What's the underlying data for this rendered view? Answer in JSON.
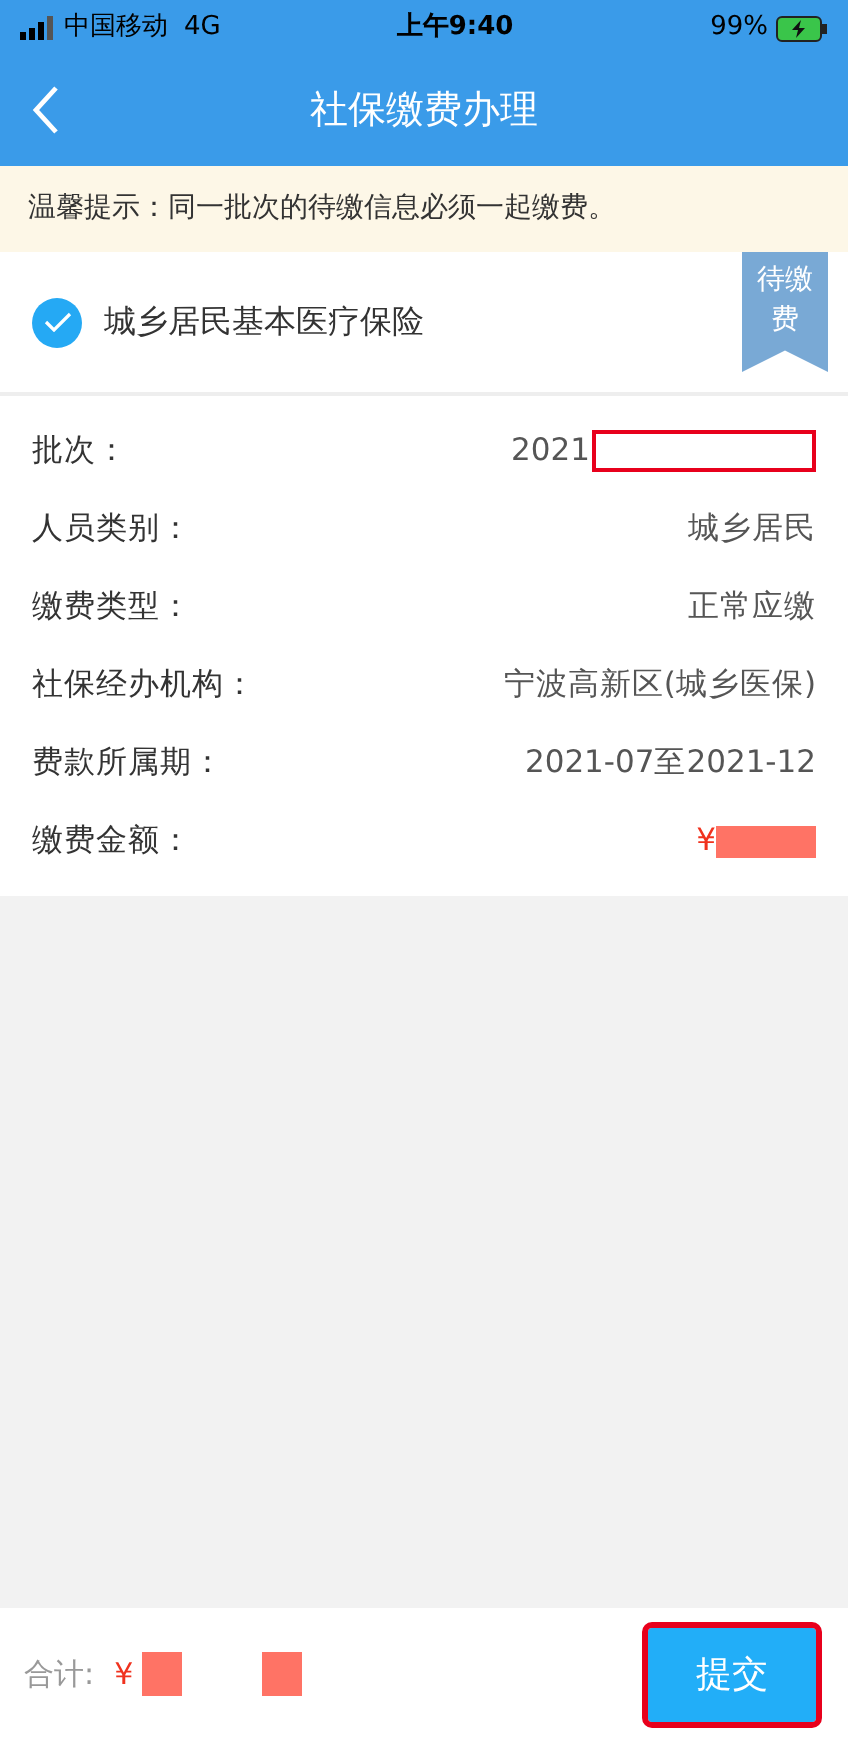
{
  "status_bar": {
    "carrier": "中国移动",
    "network": "4G",
    "time": "上午9:40",
    "battery": "99%"
  },
  "nav": {
    "title": "社保缴费办理"
  },
  "notice": "温馨提示：同一批次的待缴信息必须一起缴费。",
  "item": {
    "name": "城乡居民基本医疗保险",
    "checked": true,
    "tag": "待缴费"
  },
  "details": [
    {
      "label": "批次：",
      "value": "2021",
      "kind": "plain",
      "highlighted": true
    },
    {
      "label": "人员类别：",
      "value": "城乡居民",
      "kind": "plain",
      "highlighted": false
    },
    {
      "label": "缴费类型：",
      "value": "正常应缴",
      "kind": "plain",
      "highlighted": false
    },
    {
      "label": "社保经办机构：",
      "value": "宁波高新区(城乡医保)",
      "kind": "plain",
      "highlighted": false
    },
    {
      "label": "费款所属期：",
      "value": "2021-07至2021-12",
      "kind": "plain",
      "highlighted": false
    },
    {
      "label": "缴费金额：",
      "value": "¥",
      "kind": "amount",
      "highlighted": false
    }
  ],
  "footer": {
    "total_label": "合计:",
    "total_value": "¥",
    "submit": "提交",
    "submit_highlighted": true
  }
}
